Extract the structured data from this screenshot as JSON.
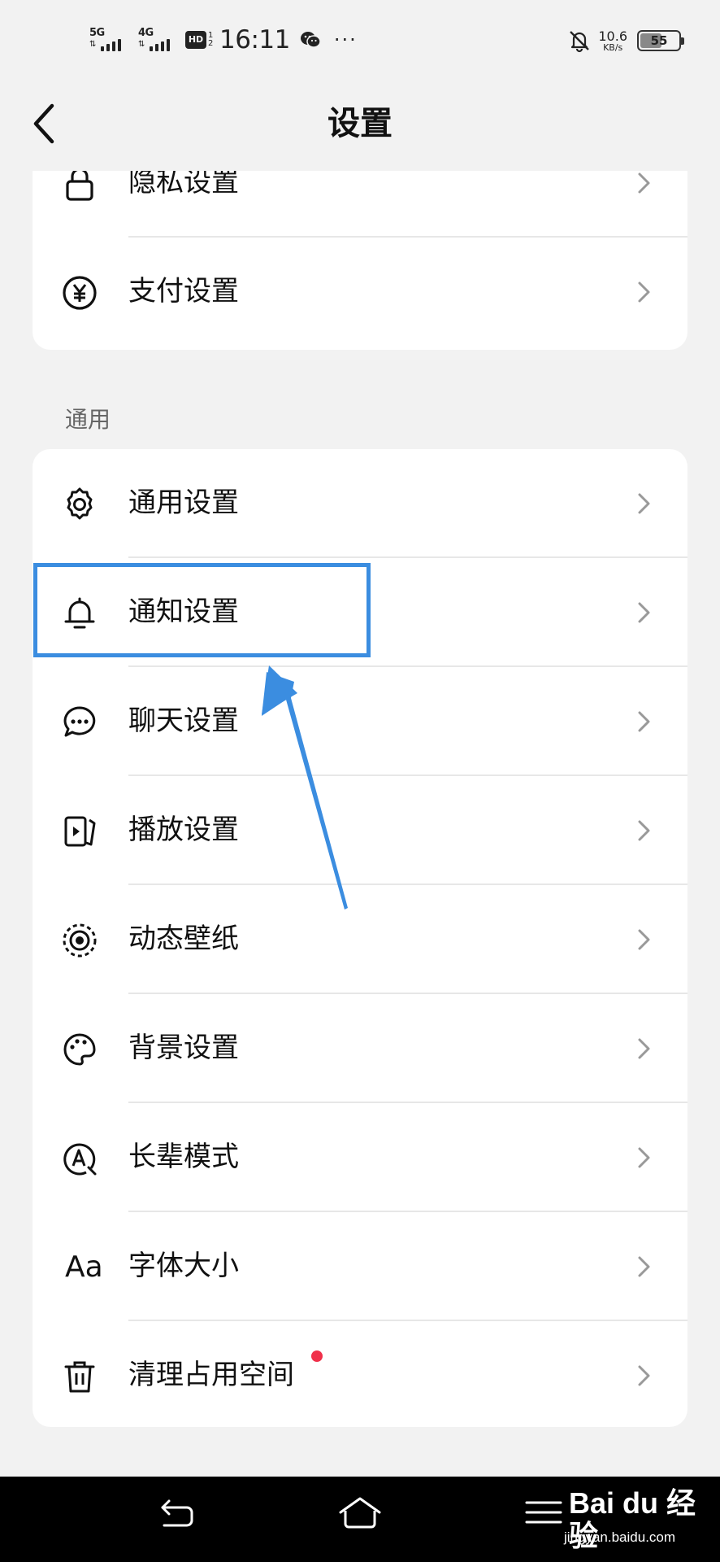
{
  "status_bar": {
    "signal1_label": "5G",
    "signal2_label": "4G",
    "hd_label": "HD",
    "hd_sub": "1 2",
    "time": "16:11",
    "more": "···",
    "net_speed_value": "10.6",
    "net_speed_unit": "KB/s",
    "battery": "55"
  },
  "header": {
    "title": "设置"
  },
  "top_group": {
    "items": [
      {
        "label": "隐私设置",
        "icon": "lock-icon"
      },
      {
        "label": "支付设置",
        "icon": "yen-icon"
      }
    ]
  },
  "general_section": {
    "label": "通用",
    "items": [
      {
        "label": "通用设置",
        "icon": "gear-icon"
      },
      {
        "label": "通知设置",
        "icon": "bell-icon",
        "highlighted": true
      },
      {
        "label": "聊天设置",
        "icon": "chat-bubble-icon"
      },
      {
        "label": "播放设置",
        "icon": "play-icon"
      },
      {
        "label": "动态壁纸",
        "icon": "live-wallpaper-icon"
      },
      {
        "label": "背景设置",
        "icon": "palette-icon"
      },
      {
        "label": "长辈模式",
        "icon": "elder-mode-icon"
      },
      {
        "label": "字体大小",
        "icon": "font-size-icon",
        "icon_text": "Aa"
      },
      {
        "label": "清理占用空间",
        "icon": "trash-icon",
        "badge": "red-dot"
      }
    ]
  },
  "annotation": {
    "highlight_color": "#3b8de0",
    "arrow_color": "#3b8de0"
  },
  "watermark": {
    "logo": "Bai du 经验",
    "url": "jingyan.baidu.com"
  }
}
